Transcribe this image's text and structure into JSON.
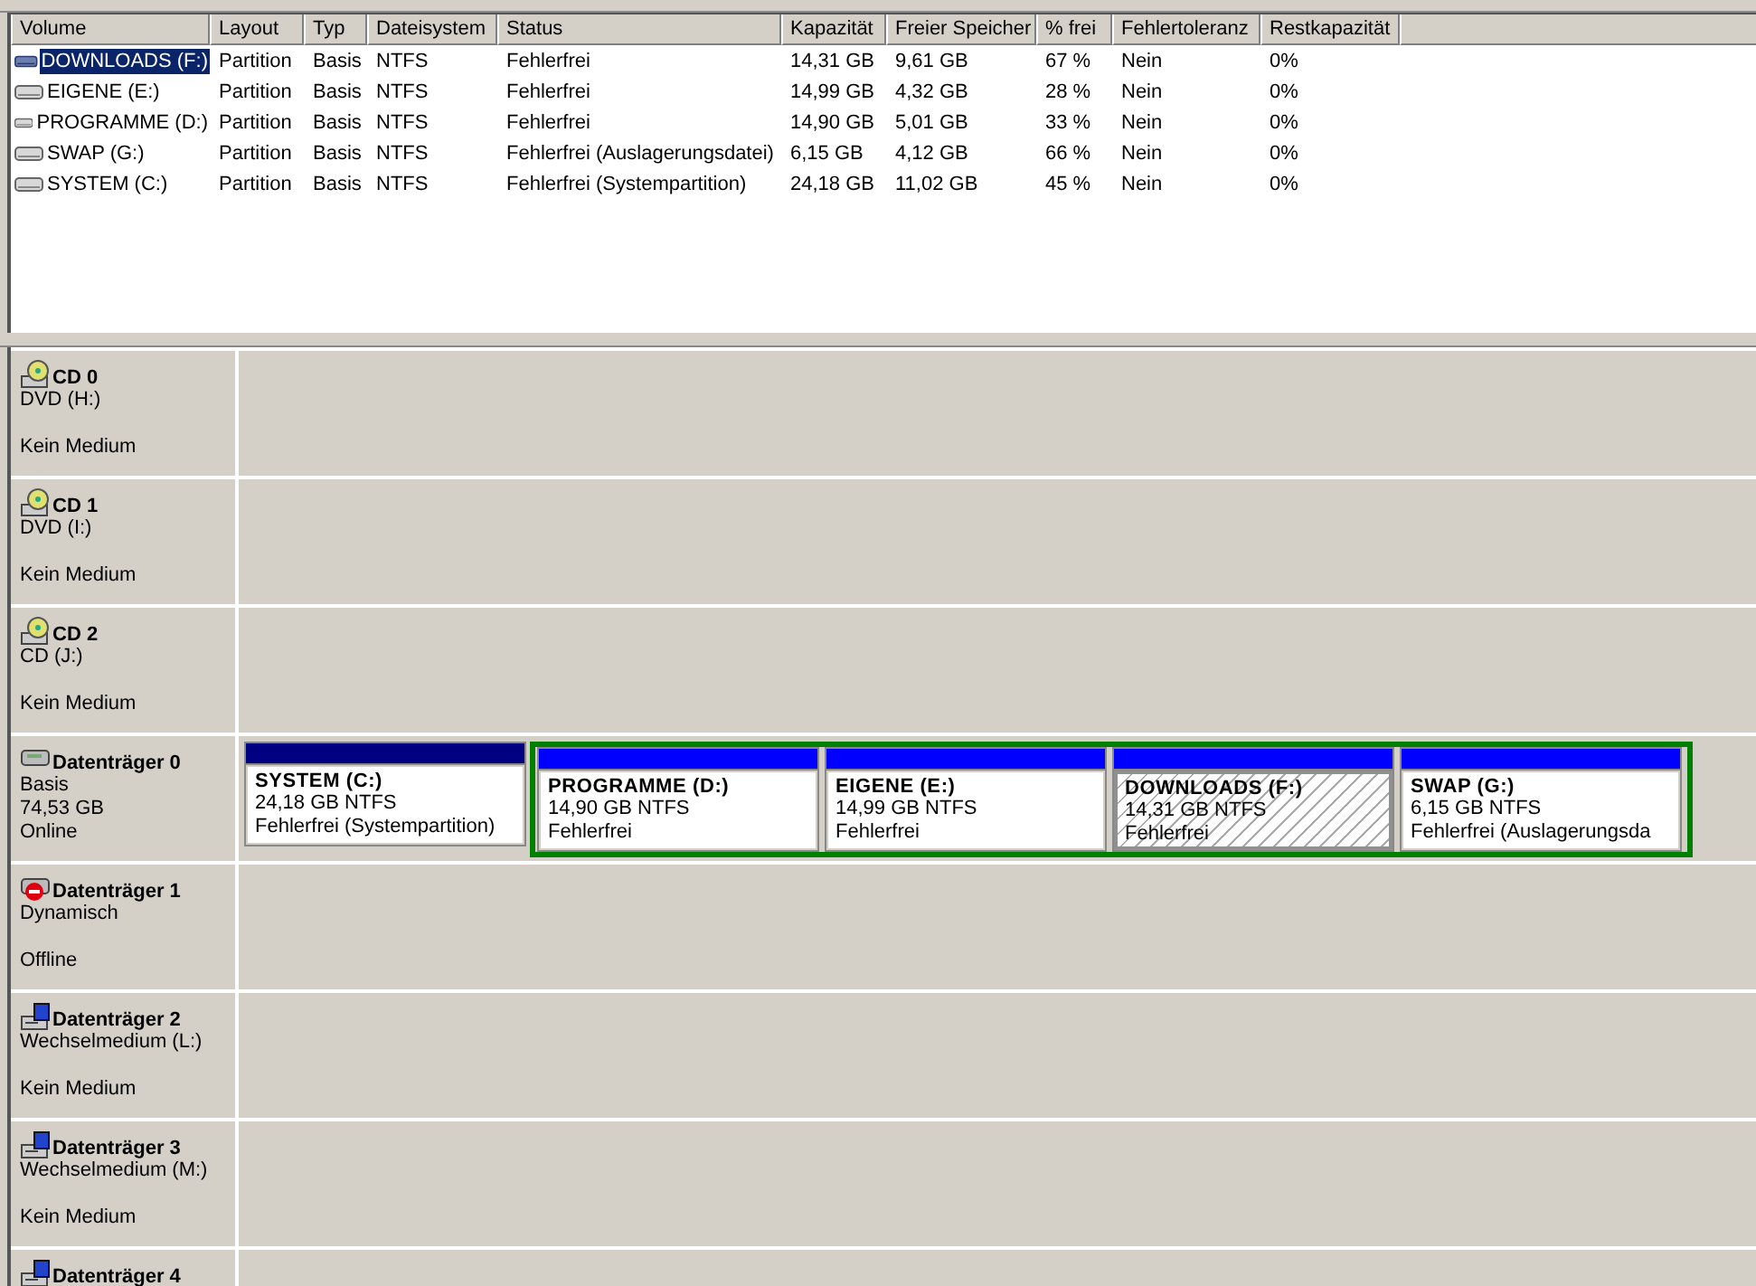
{
  "volume_table": {
    "columns": [
      "Volume",
      "Layout",
      "Typ",
      "Dateisystem",
      "Status",
      "Kapazität",
      "Freier Speicher",
      "% frei",
      "Fehlertoleranz",
      "Restkapazität"
    ],
    "rows": [
      {
        "selected": true,
        "cells": [
          "DOWNLOADS (F:)",
          "Partition",
          "Basis",
          "NTFS",
          "Fehlerfrei",
          "14,31 GB",
          "9,61 GB",
          "67 %",
          "Nein",
          "0%"
        ]
      },
      {
        "selected": false,
        "cells": [
          "EIGENE (E:)",
          "Partition",
          "Basis",
          "NTFS",
          "Fehlerfrei",
          "14,99 GB",
          "4,32 GB",
          "28 %",
          "Nein",
          "0%"
        ]
      },
      {
        "selected": false,
        "cells": [
          "PROGRAMME (D:)",
          "Partition",
          "Basis",
          "NTFS",
          "Fehlerfrei",
          "14,90 GB",
          "5,01 GB",
          "33 %",
          "Nein",
          "0%"
        ]
      },
      {
        "selected": false,
        "cells": [
          "SWAP (G:)",
          "Partition",
          "Basis",
          "NTFS",
          "Fehlerfrei (Auslagerungsdatei)",
          "6,15 GB",
          "4,12 GB",
          "66 %",
          "Nein",
          "0%"
        ]
      },
      {
        "selected": false,
        "cells": [
          "SYSTEM (C:)",
          "Partition",
          "Basis",
          "NTFS",
          "Fehlerfrei (Systempartition)",
          "24,18 GB",
          "11,02 GB",
          "45 %",
          "Nein",
          "0%"
        ]
      }
    ]
  },
  "disks": [
    {
      "kind": "cdrom",
      "name": "CD 0",
      "details": [
        "DVD (H:)"
      ],
      "status": "Kein Medium"
    },
    {
      "kind": "cdrom",
      "name": "CD 1",
      "details": [
        "DVD (I:)"
      ],
      "status": "Kein Medium"
    },
    {
      "kind": "cdrom",
      "name": "CD 2",
      "details": [
        "CD (J:)"
      ],
      "status": "Kein Medium"
    },
    {
      "kind": "disk",
      "name": "Datenträger 0",
      "details": [
        "Basis",
        "74,53 GB"
      ],
      "status": "Online",
      "partitions": [
        {
          "kind": "primary",
          "selected": false,
          "name": "SYSTEM  (C:)",
          "size": "24,18 GB NTFS",
          "status": "Fehlerfrei (Systempartition)"
        },
        {
          "kind": "logical",
          "selected": false,
          "name": "PROGRAMME  (D:)",
          "size": "14,90 GB NTFS",
          "status": "Fehlerfrei"
        },
        {
          "kind": "logical",
          "selected": false,
          "name": "EIGENE  (E:)",
          "size": "14,99 GB NTFS",
          "status": "Fehlerfrei"
        },
        {
          "kind": "logical",
          "selected": true,
          "name": "DOWNLOADS  (F:)",
          "size": "14,31 GB NTFS",
          "status": "Fehlerfrei"
        },
        {
          "kind": "logical",
          "selected": false,
          "name": "SWAP  (G:)",
          "size": "6,15 GB NTFS",
          "status": "Fehlerfrei (Auslagerungsda"
        }
      ]
    },
    {
      "kind": "offline_disk",
      "name": "Datenträger 1",
      "details": [
        "Dynamisch"
      ],
      "status": "Offline"
    },
    {
      "kind": "removable",
      "name": "Datenträger 2",
      "details": [
        "Wechselmedium (L:)"
      ],
      "status": "Kein Medium"
    },
    {
      "kind": "removable",
      "name": "Datenträger 3",
      "details": [
        "Wechselmedium (M:)"
      ],
      "status": "Kein Medium"
    },
    {
      "kind": "removable",
      "name": "Datenträger 4"
    }
  ]
}
